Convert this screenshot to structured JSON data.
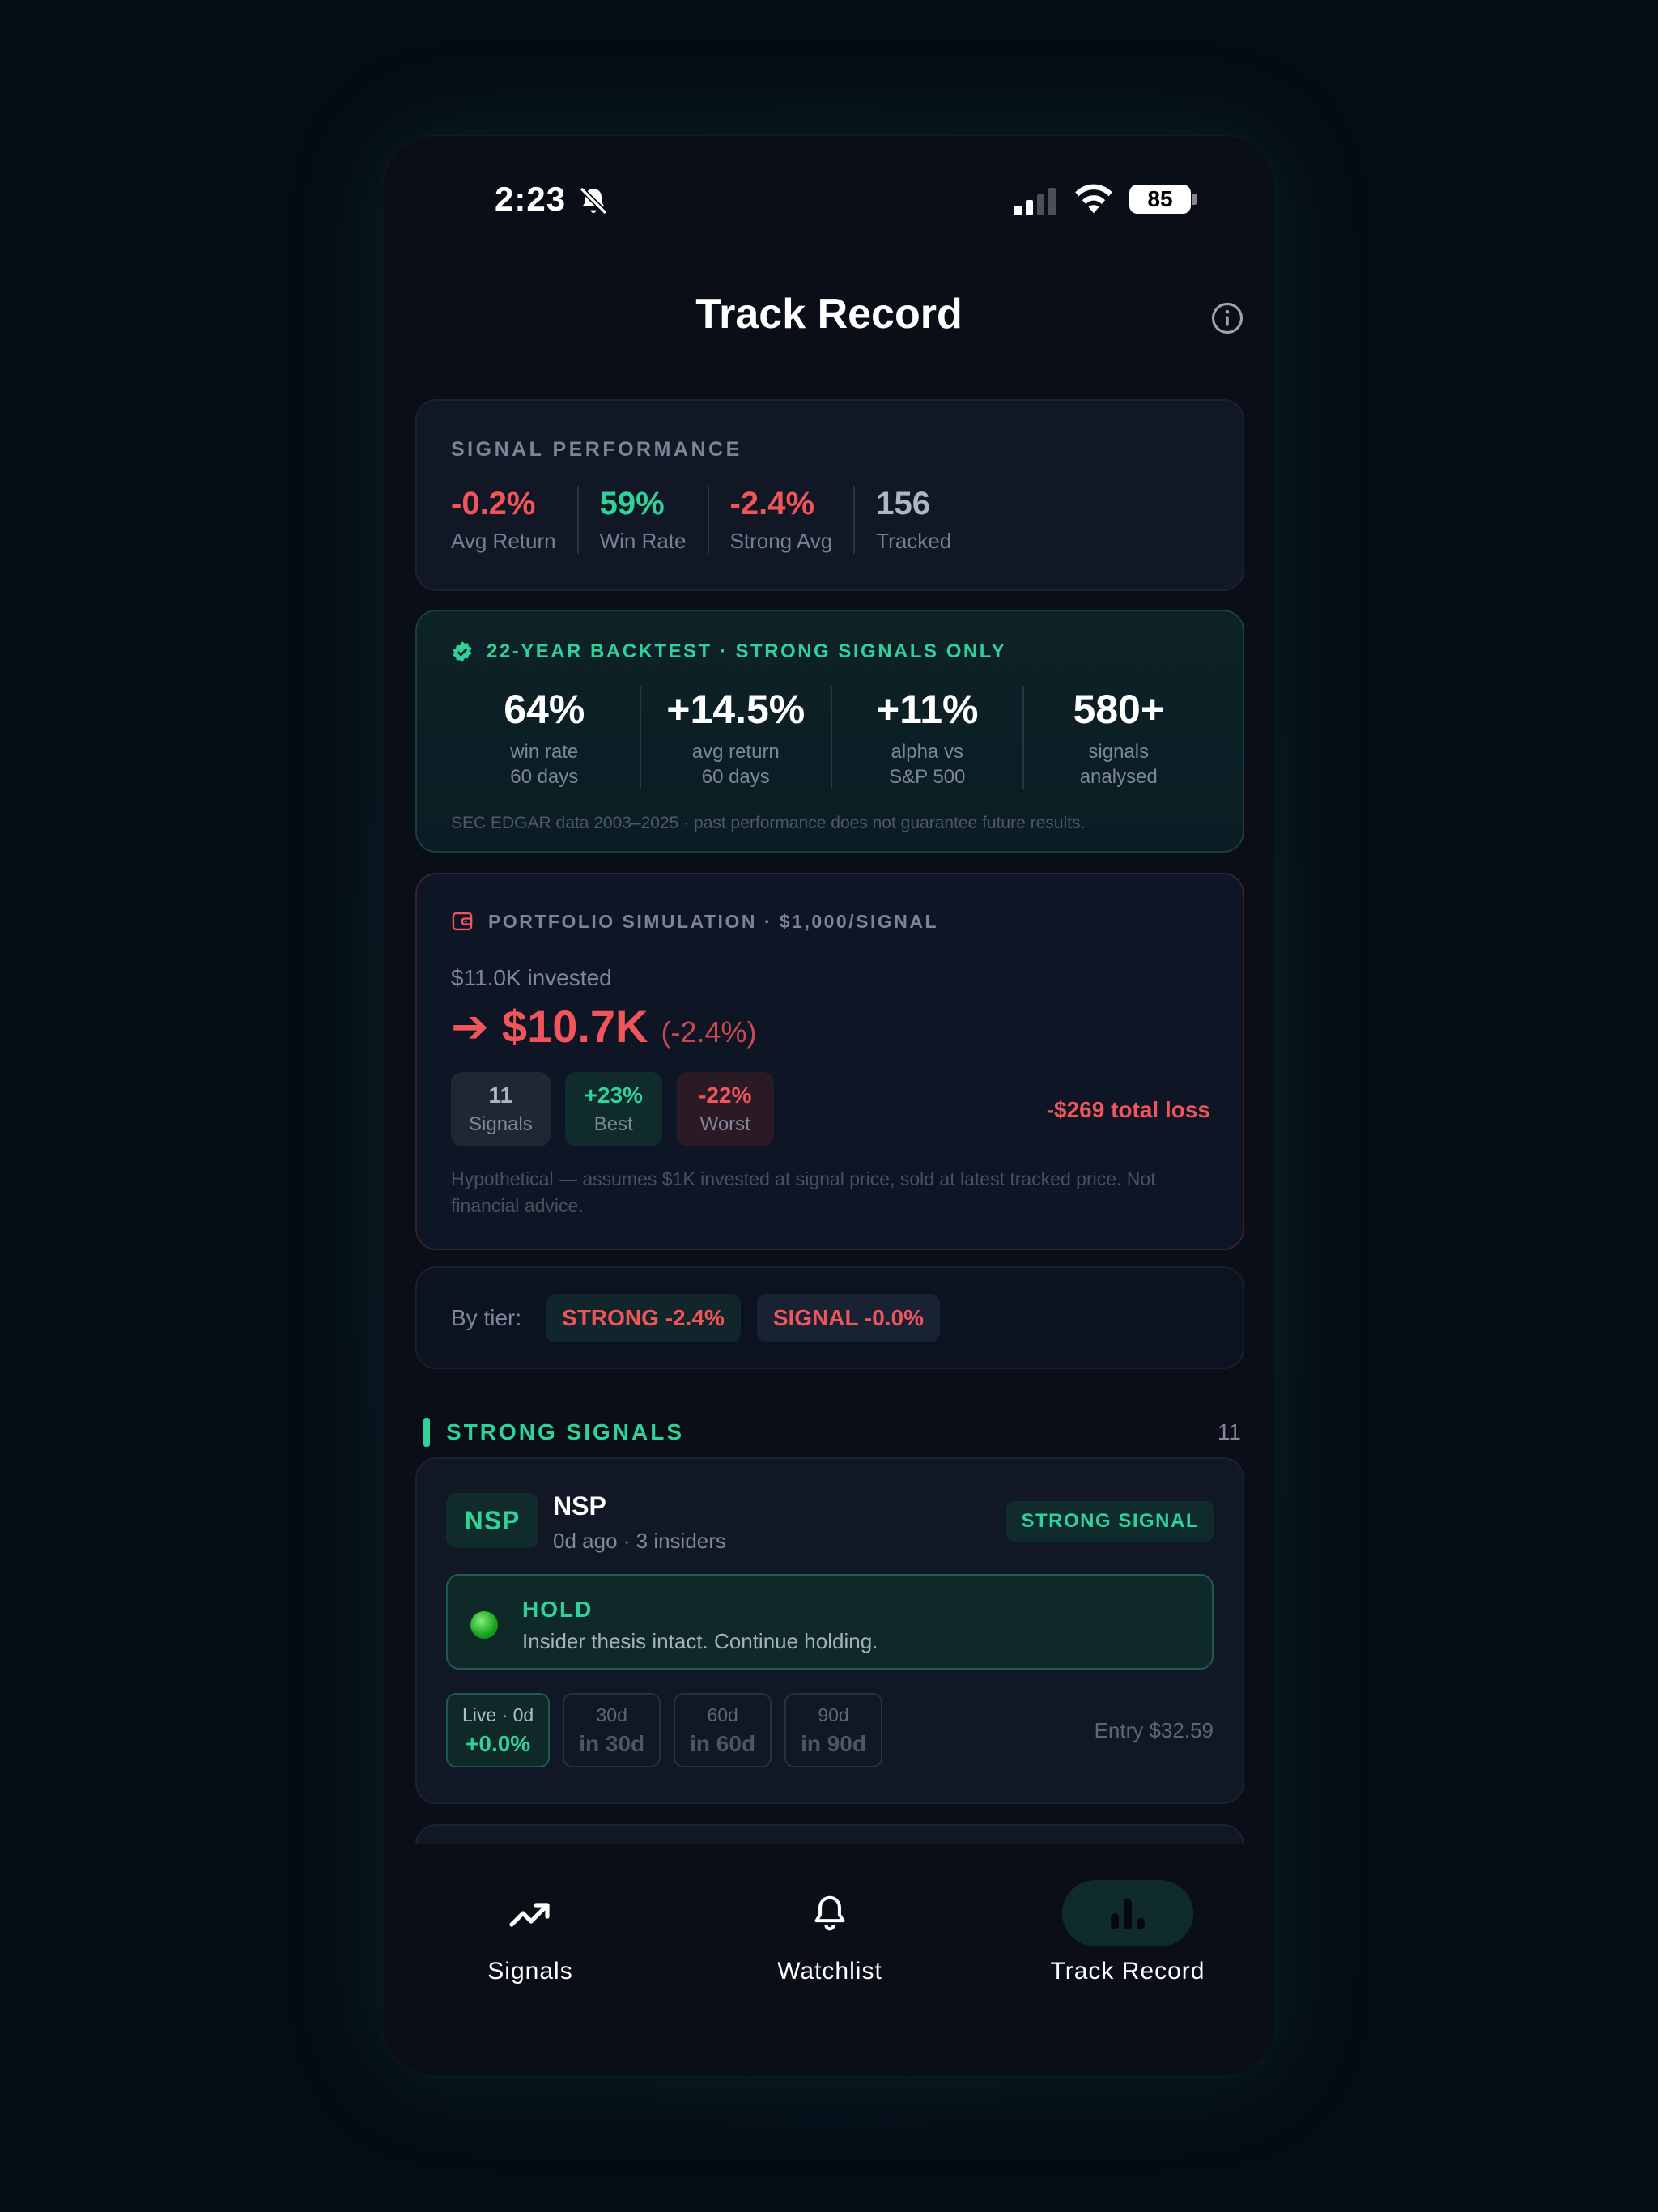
{
  "status": {
    "time": "2:23",
    "battery": "85"
  },
  "header": {
    "title": "Track Record"
  },
  "performance": {
    "label": "SIGNAL PERFORMANCE",
    "stats": [
      {
        "value": "-0.2%",
        "label": "Avg Return"
      },
      {
        "value": "59%",
        "label": "Win Rate"
      },
      {
        "value": "-2.4%",
        "label": "Strong Avg"
      },
      {
        "value": "156",
        "label": "Tracked"
      }
    ]
  },
  "backtest": {
    "label": "22-YEAR BACKTEST · STRONG SIGNALS ONLY",
    "stats": [
      {
        "value": "64%",
        "line1": "win rate",
        "line2": "60 days"
      },
      {
        "value": "+14.5%",
        "line1": "avg return",
        "line2": "60 days"
      },
      {
        "value": "+11%",
        "line1": "alpha vs",
        "line2": "S&P 500"
      },
      {
        "value": "580+",
        "line1": "signals",
        "line2": "analysed"
      }
    ],
    "note": "SEC EDGAR data 2003–2025 · past performance does not guarantee future results."
  },
  "portfolio": {
    "label": "PORTFOLIO SIMULATION · $1,000/SIGNAL",
    "invested": "$11.0K invested",
    "arrow": "➔",
    "current_value": "$10.7K",
    "change_pct": "(-2.4%)",
    "chips": [
      {
        "value": "11",
        "label": "Signals"
      },
      {
        "value": "+23%",
        "label": "Best"
      },
      {
        "value": "-22%",
        "label": "Worst"
      }
    ],
    "total": "-$269 total loss",
    "note": "Hypothetical — assumes $1K invested at signal price, sold at latest tracked price. Not financial advice."
  },
  "tiers": {
    "label": "By tier:",
    "items": [
      {
        "text": "STRONG -2.4%"
      },
      {
        "text": "SIGNAL -0.0%"
      }
    ]
  },
  "section": {
    "title": "STRONG SIGNALS",
    "count": "11"
  },
  "signal_card": {
    "ticker": "NSP",
    "name": "NSP",
    "meta": "0d ago · 3 insiders",
    "tag": "STRONG SIGNAL",
    "hold_title": "HOLD",
    "hold_text": "Insider thesis intact. Continue holding.",
    "periods": [
      {
        "top": "Live · 0d",
        "bottom": "+0.0%"
      },
      {
        "top": "30d",
        "bottom": "in 30d"
      },
      {
        "top": "60d",
        "bottom": "in 60d"
      },
      {
        "top": "90d",
        "bottom": "in 90d"
      }
    ],
    "entry": "Entry $32.59"
  },
  "tabs": [
    {
      "label": "Signals",
      "icon": "trending-up-icon"
    },
    {
      "label": "Watchlist",
      "icon": "bell-icon"
    },
    {
      "label": "Track Record",
      "icon": "bar-chart-icon"
    }
  ],
  "colors": {
    "accent_green": "#2fd39a",
    "loss_red": "#f0555b",
    "background": "#0a0e17"
  }
}
